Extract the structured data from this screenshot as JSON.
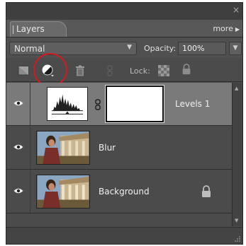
{
  "panel": {
    "close_glyph": "×",
    "tab_label": "Layers",
    "more_label": "more",
    "more_arrow": "▶"
  },
  "options": {
    "blend_mode": "Normal",
    "opacity_label": "Opacity:",
    "opacity_value": "100%"
  },
  "toolbar": {
    "lock_label": "Lock:",
    "icons": [
      "new-layer-icon",
      "adjustment-layer-icon",
      "trash-icon",
      "link-icon",
      "lock-transparent-pixels-icon",
      "lock-all-icon"
    ]
  },
  "layers": [
    {
      "name": "Levels 1",
      "selected": true,
      "type": "adjustment"
    },
    {
      "name": "Blur",
      "selected": false,
      "type": "photo"
    },
    {
      "name": "Background",
      "selected": false,
      "type": "photo",
      "locked": true
    }
  ],
  "colors": {
    "panel_bg": "#4b4b4b",
    "selected_row": "#7a7a7a",
    "highlight_circle": "#d01a20"
  }
}
